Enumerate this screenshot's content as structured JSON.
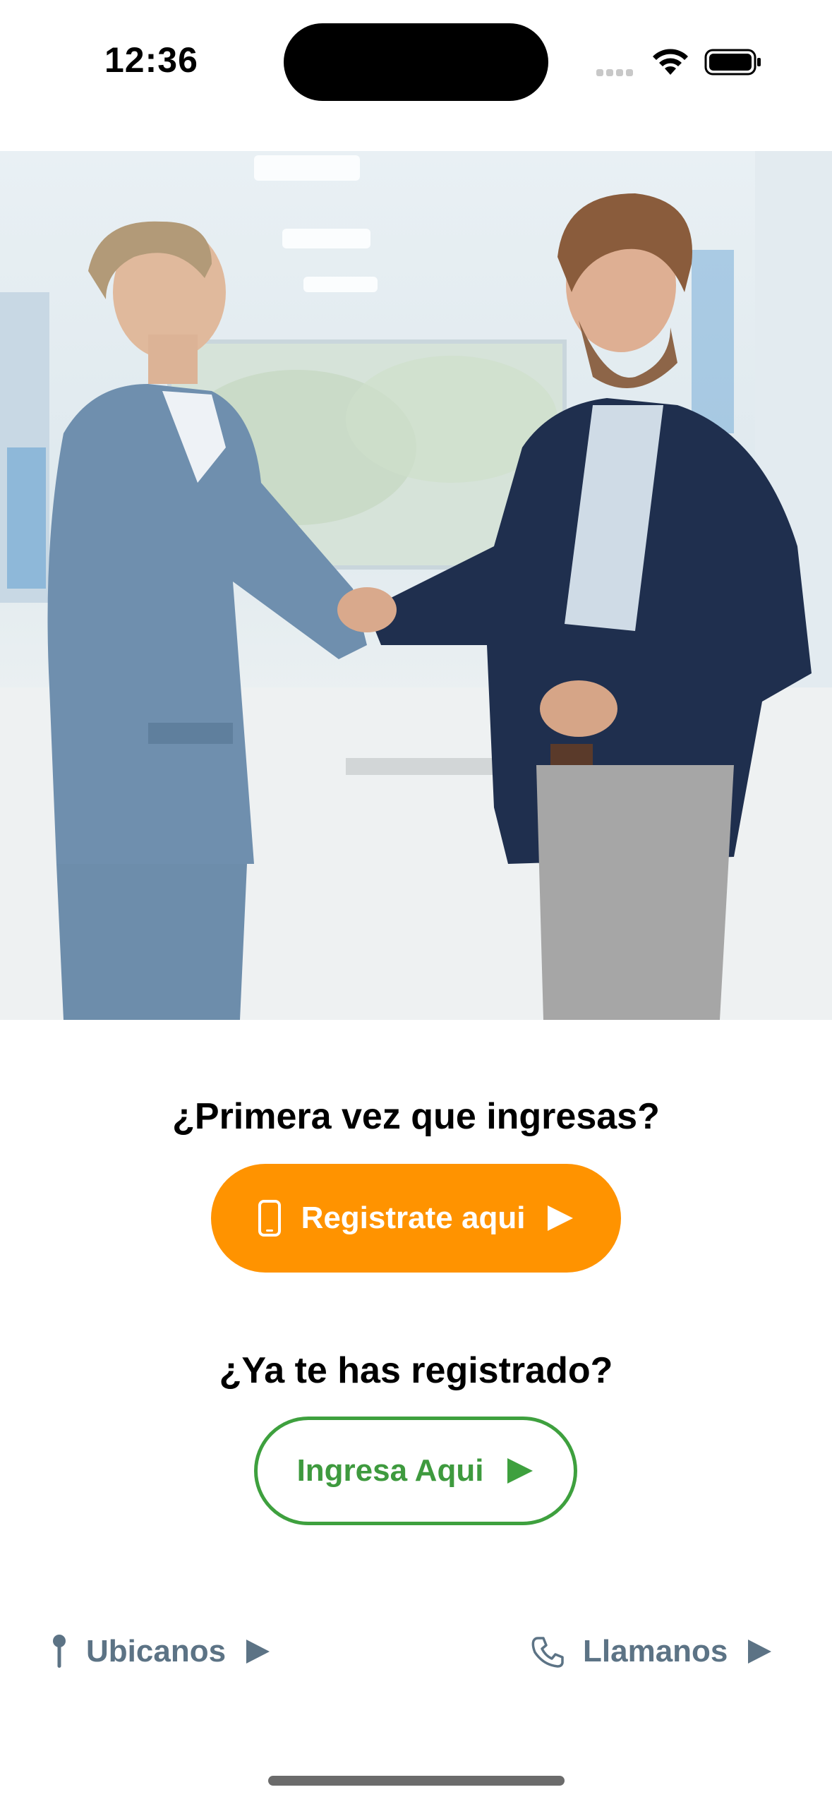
{
  "status_bar": {
    "time": "12:36"
  },
  "hero": {
    "image_icon": "handshake-photo"
  },
  "register_section": {
    "question": "¿Primera vez que ingresas?",
    "button_label": "Registrate aqui",
    "button_color": "#FF9300",
    "icon": "phone-icon"
  },
  "login_section": {
    "question": "¿Ya te has registrado?",
    "button_label": "Ingresa Aqui",
    "button_color": "#3EA03E"
  },
  "footer": {
    "locate_label": "Ubicanos",
    "call_label": "Llamanos",
    "link_color": "#5C7385"
  }
}
